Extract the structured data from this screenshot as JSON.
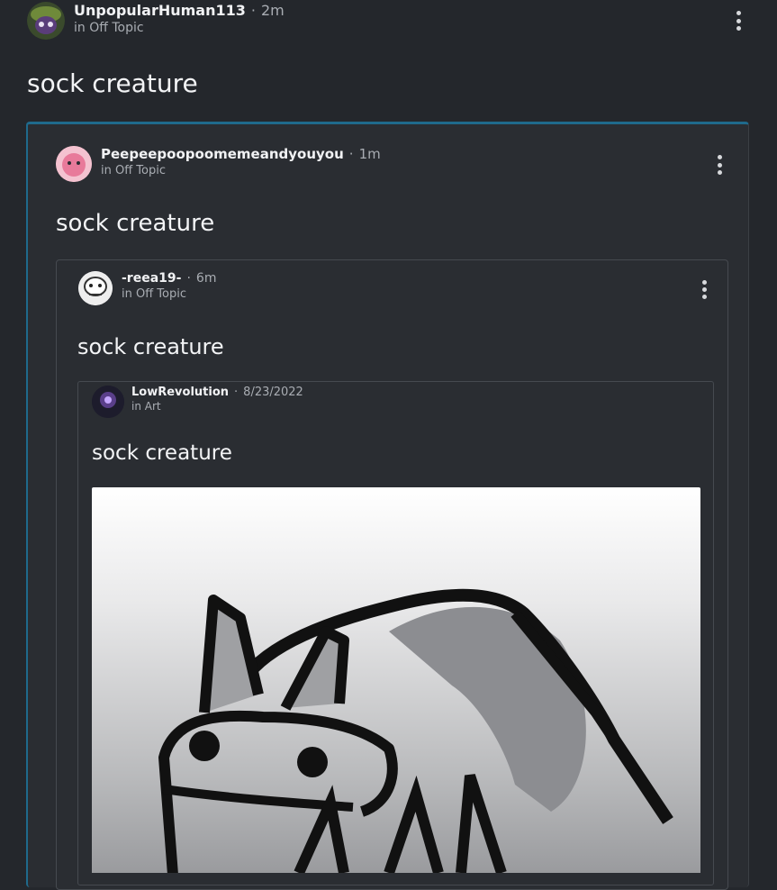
{
  "posts": [
    {
      "username": "UnpopularHuman113",
      "time": "2m",
      "category": "in Off Topic",
      "title": "sock creature"
    },
    {
      "username": "Peepeepoopoomemeandyouyou",
      "time": "1m",
      "category": "in Off Topic",
      "title": "sock creature"
    },
    {
      "username": "-reea19-",
      "time": "6m",
      "category": "in Off Topic",
      "title": "sock creature"
    },
    {
      "username": "LowRevolution",
      "time": "8/23/2022",
      "category": "in Art",
      "title": "sock creature"
    }
  ],
  "separator": "·",
  "icons": {
    "menu": "more-vertical-icon"
  },
  "colors": {
    "background": "#24272c",
    "card": "#2a2d32",
    "accent_border": "#1f6a8c"
  }
}
